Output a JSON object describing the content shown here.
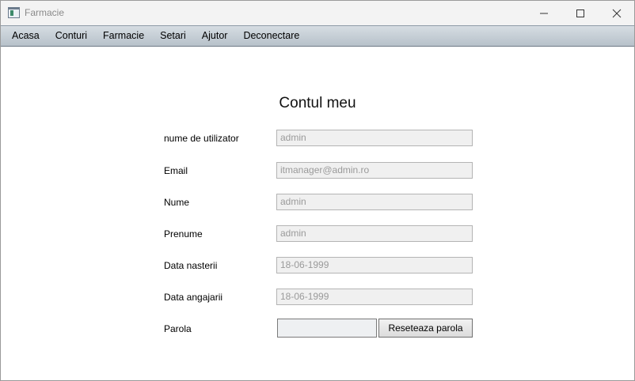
{
  "window": {
    "title": "Farmacie"
  },
  "menu": {
    "items": [
      "Acasa",
      "Conturi",
      "Farmacie",
      "Setari",
      "Ajutor",
      "Deconectare"
    ]
  },
  "account": {
    "title": "Contul meu",
    "fields": [
      {
        "label": "nume de utilizator",
        "value": "admin"
      },
      {
        "label": "Email",
        "value": "itmanager@admin.ro"
      },
      {
        "label": "Nume",
        "value": "admin"
      },
      {
        "label": "Prenume",
        "value": "admin"
      },
      {
        "label": "Data nasterii",
        "value": "18-06-1999"
      },
      {
        "label": "Data angajarii",
        "value": "18-06-1999"
      }
    ],
    "password": {
      "label": "Parola",
      "value": "",
      "reset_label": "Reseteaza parola"
    }
  },
  "icons": {
    "app": "app-window-icon",
    "minimize": "minimize-icon",
    "maximize": "maximize-icon",
    "close": "close-icon"
  }
}
